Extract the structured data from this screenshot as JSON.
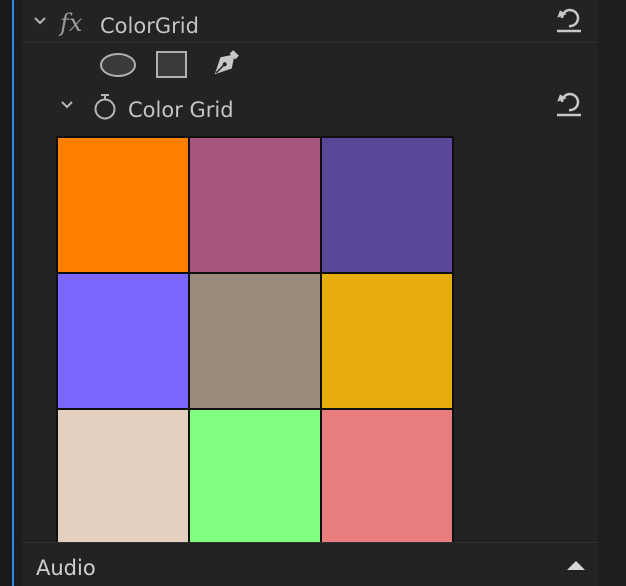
{
  "effect": {
    "fx_label": "fx",
    "name": "ColorGrid"
  },
  "tools": [
    "ellipse-mask",
    "rectangle-mask",
    "pen-mask"
  ],
  "property": {
    "name": "Color Grid"
  },
  "color_grid": {
    "rows": 3,
    "cols": 3,
    "colors": [
      "#ff7f00",
      "#a8557f",
      "#5a4799",
      "#7b67ff",
      "#998a7c",
      "#e6ad0d",
      "#e3d0c0",
      "#80ff80",
      "#e77d7d"
    ]
  },
  "audio": {
    "label": "Audio"
  },
  "accent_color": "#2d8ceb"
}
